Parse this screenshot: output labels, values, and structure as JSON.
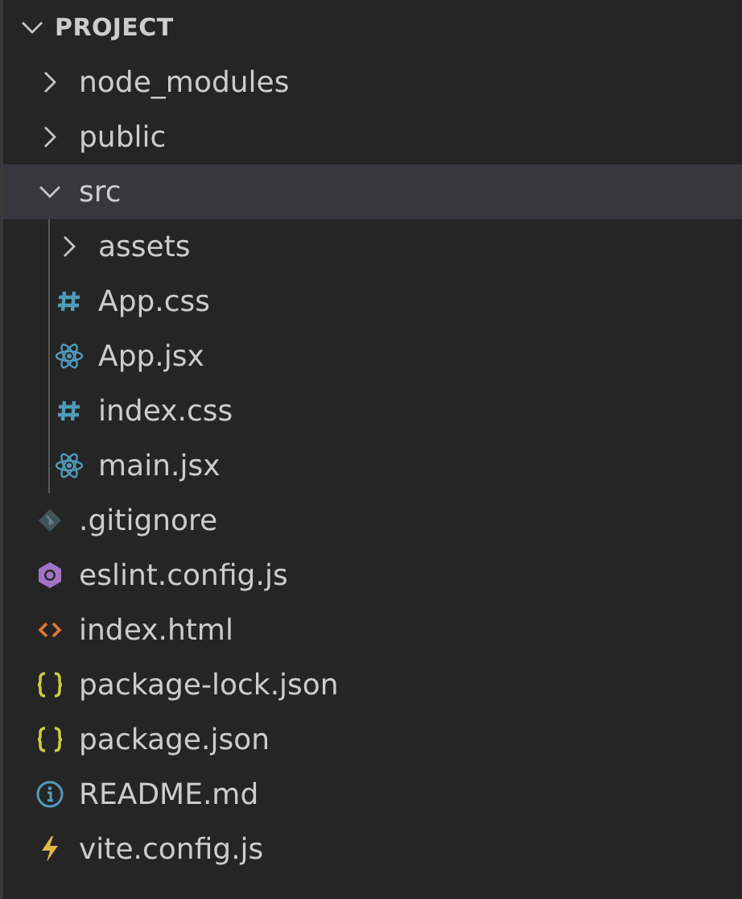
{
  "section": {
    "title": "PROJECT",
    "expanded": true
  },
  "tree": [
    {
      "name": "node_modules",
      "kind": "folder",
      "expanded": false,
      "selected": false
    },
    {
      "name": "public",
      "kind": "folder",
      "expanded": false,
      "selected": false
    },
    {
      "name": "src",
      "kind": "folder",
      "expanded": true,
      "selected": true,
      "children": [
        {
          "name": "assets",
          "kind": "folder",
          "expanded": false,
          "selected": false
        },
        {
          "name": "App.css",
          "kind": "css",
          "selected": false
        },
        {
          "name": "App.jsx",
          "kind": "react",
          "selected": false
        },
        {
          "name": "index.css",
          "kind": "css",
          "selected": false
        },
        {
          "name": "main.jsx",
          "kind": "react",
          "selected": false
        }
      ]
    },
    {
      "name": ".gitignore",
      "kind": "git",
      "selected": false
    },
    {
      "name": "eslint.config.js",
      "kind": "eslint",
      "selected": false
    },
    {
      "name": "index.html",
      "kind": "html",
      "selected": false
    },
    {
      "name": "package-lock.json",
      "kind": "json",
      "selected": false
    },
    {
      "name": "package.json",
      "kind": "json",
      "selected": false
    },
    {
      "name": "README.md",
      "kind": "info",
      "selected": false
    },
    {
      "name": "vite.config.js",
      "kind": "vite",
      "selected": false
    }
  ]
}
